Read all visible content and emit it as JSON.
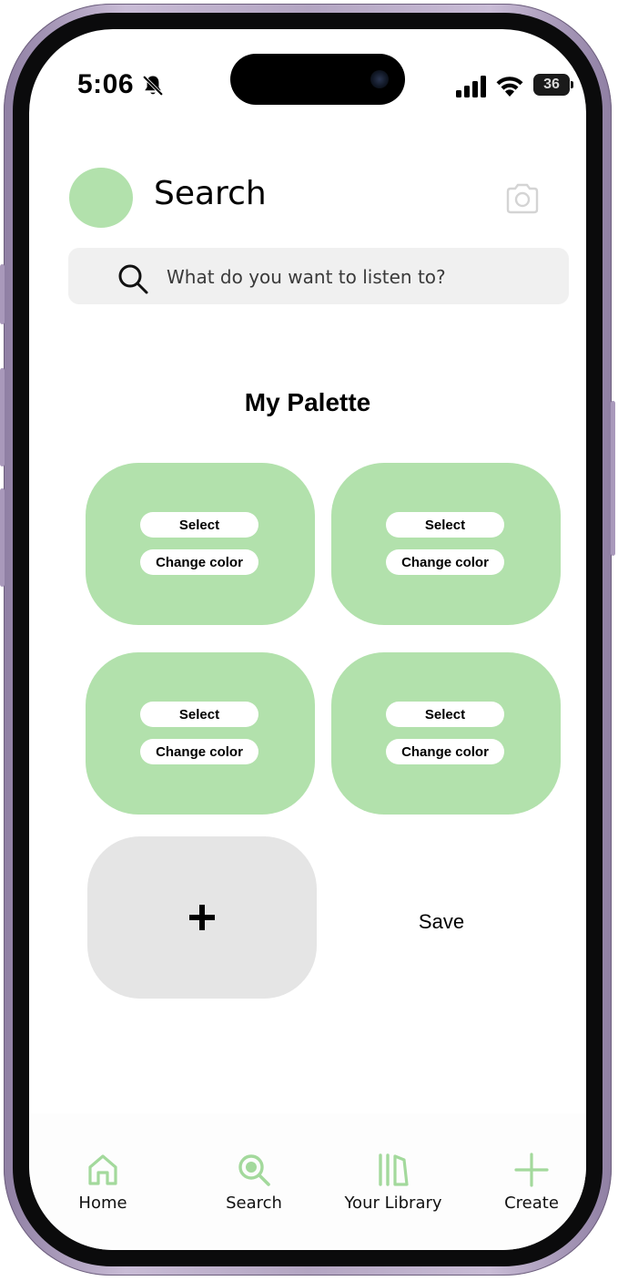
{
  "status_bar": {
    "time": "5:06",
    "battery": "36",
    "icons": [
      "bell-slash-icon",
      "signal-icon",
      "wifi-icon",
      "battery-icon"
    ]
  },
  "header": {
    "title": "Search",
    "avatar_color": "#b2e1ac",
    "camera_icon": "camera-icon"
  },
  "search": {
    "placeholder": "What do you want to listen to?",
    "value": ""
  },
  "palette": {
    "title": "My Palette",
    "swatches": [
      {
        "color": "#b2e1ac",
        "select_label": "Select",
        "change_label": "Change color"
      },
      {
        "color": "#b2e1ac",
        "select_label": "Select",
        "change_label": "Change color"
      },
      {
        "color": "#b2e1ac",
        "select_label": "Select",
        "change_label": "Change color"
      },
      {
        "color": "#b2e1ac",
        "select_label": "Select",
        "change_label": "Change color"
      }
    ],
    "add_icon": "plus-icon",
    "save_label": "Save"
  },
  "nav": {
    "accent": "#a3d99c",
    "items": [
      {
        "label": "Home",
        "icon": "home-icon"
      },
      {
        "label": "Search",
        "icon": "search-icon"
      },
      {
        "label": "Your Library",
        "icon": "library-icon"
      },
      {
        "label": "Create",
        "icon": "plus-icon"
      }
    ]
  }
}
